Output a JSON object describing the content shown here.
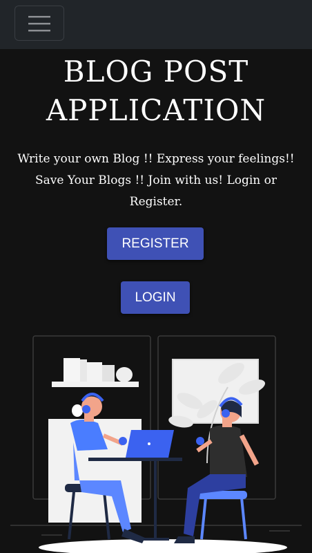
{
  "navbar": {
    "toggler_icon": "hamburger-menu-icon"
  },
  "hero": {
    "title_line1": "BLOG POST",
    "title_line2": "APPLICATION",
    "tagline_line1": "Write your own Blog !! Express your feelings!!",
    "tagline_line2": "Save Your Blogs !! Join with us! Login or",
    "tagline_line3": "Register."
  },
  "buttons": {
    "register_label": "REGISTER",
    "login_label": "LOGIN"
  },
  "colors": {
    "navbar": "#212529",
    "background": "#121212",
    "accent": "#3f51b5",
    "illustration_blue": "#3b62f0"
  }
}
